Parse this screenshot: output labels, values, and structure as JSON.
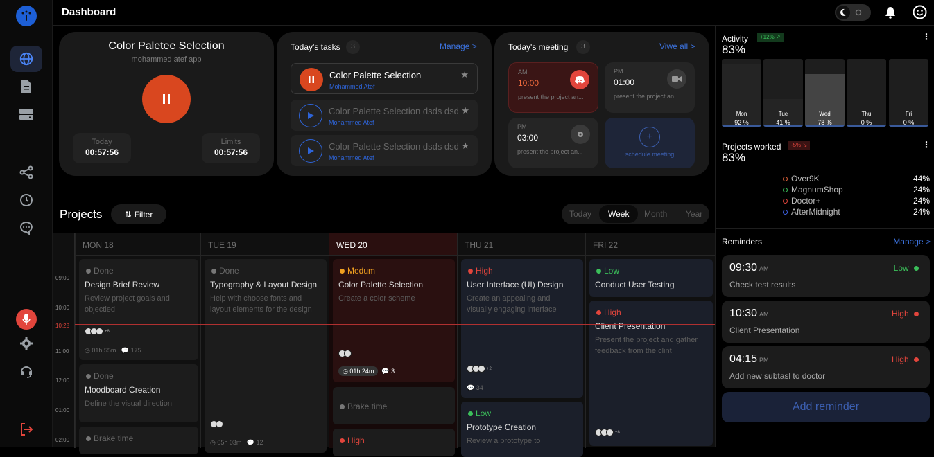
{
  "header": {
    "title": "Dashboard"
  },
  "focus": {
    "title": "Color Paletee Selection",
    "app": "mohammed atef app",
    "today_label": "Today",
    "today_value": "00:57:56",
    "limits_label": "Limits",
    "limits_value": "00:57:56"
  },
  "tasks": {
    "title": "Today's tasks",
    "count": "3",
    "manage": "Manage >",
    "items": [
      {
        "name": "Color Palette Selection",
        "owner": "Mohammed Atef"
      },
      {
        "name": "Color Palette Selection dsds dsd",
        "owner": "Mohammed Atef"
      },
      {
        "name": "Color Palette Selection dsds dsd",
        "owner": "Mohammed Atef"
      }
    ]
  },
  "meetings": {
    "title": "Today's meeting",
    "count": "3",
    "view_all": "Viwe all >",
    "items": [
      {
        "ampm": "AM",
        "time": "10:00",
        "desc": "present the project an..."
      },
      {
        "ampm": "PM",
        "time": "01:00",
        "desc": "present the project an..."
      },
      {
        "ampm": "PM",
        "time": "03:00",
        "desc": "present the project an..."
      }
    ],
    "schedule": "schedule meeting"
  },
  "projects": {
    "title": "Projects",
    "filter": "Filter",
    "ranges": [
      "Today",
      "Week",
      "Month",
      "Year"
    ],
    "active_range": "Week",
    "times": [
      "09:00",
      "10:00",
      "10:28",
      "11:00",
      "12:00",
      "01:00",
      "02:00"
    ],
    "days": [
      "MON 18",
      "TUE 19",
      "WED 20",
      "THU 21",
      "FRI 22"
    ],
    "events": {
      "mon1": {
        "status": "Done",
        "name": "Design Brief Review",
        "desc": "Review project goals and objectied",
        "avatars_more": "+8",
        "duration": "01h 55m",
        "comments": "175"
      },
      "mon2": {
        "status": "Done",
        "name": "Moodboard Creation",
        "desc": "Define the visual direction"
      },
      "mon3": {
        "status": "Brake time"
      },
      "tue1": {
        "status": "Done",
        "name": "Typography & Layout Design",
        "desc": "Help with choose fonts and layout elements for the design",
        "duration": "05h 03m",
        "comments": "12"
      },
      "wed1": {
        "status": "Medum",
        "name": "Color Palette Selection",
        "desc": "Create a color scheme",
        "duration": "01h:24m",
        "comments": "3"
      },
      "wed2": {
        "status": "Brake time"
      },
      "wed3": {
        "status": "High"
      },
      "thu1": {
        "status": "High",
        "name": "User Interface (UI) Design",
        "desc": "Create an appealing and visually engaging interface",
        "avatars_more": "+2",
        "comments": "34"
      },
      "thu2": {
        "status": "Low",
        "name": "Prototype Creation",
        "desc": "Review a prototype to"
      },
      "fri1": {
        "status": "Low",
        "name": "Conduct User Testing"
      },
      "fri2": {
        "status": "High",
        "name": "Client Presentation",
        "desc": "Present the project and gather feedback from the clint",
        "avatars_more": "+8"
      }
    }
  },
  "activity": {
    "title": "Activity",
    "change": "+12%",
    "value": "83%",
    "bars": [
      {
        "day": "Mon",
        "pct": "92 %",
        "level": 0.92
      },
      {
        "day": "Tue",
        "pct": "41 %",
        "level": 0.41
      },
      {
        "day": "Wed",
        "pct": "78 %",
        "level": 0.78
      },
      {
        "day": "Thu",
        "pct": "0 %",
        "level": 0
      },
      {
        "day": "Fri",
        "pct": "0 %",
        "level": 0
      }
    ]
  },
  "projects_worked": {
    "title": "Projects worked",
    "change": "-5%",
    "value": "83%",
    "items": [
      {
        "name": "Over9K",
        "pct": "44%",
        "color": "#e0623a"
      },
      {
        "name": "MagnumShop",
        "pct": "24%",
        "color": "#3bbf5a"
      },
      {
        "name": "Doctor+",
        "pct": "24%",
        "color": "#e0453c"
      },
      {
        "name": "AfterMidnight",
        "pct": "24%",
        "color": "#3c5fe0"
      }
    ]
  },
  "reminders": {
    "title": "Reminders",
    "manage": "Manage >",
    "add": "Add reminder",
    "items": [
      {
        "time": "09:30",
        "ampm": "AM",
        "desc": "Check test results",
        "priority": "Low"
      },
      {
        "time": "10:30",
        "ampm": "AM",
        "desc": "Client Presentation",
        "priority": "High"
      },
      {
        "time": "04:15",
        "ampm": "PM",
        "desc": "Add new subtasl to doctor",
        "priority": "High"
      }
    ]
  }
}
